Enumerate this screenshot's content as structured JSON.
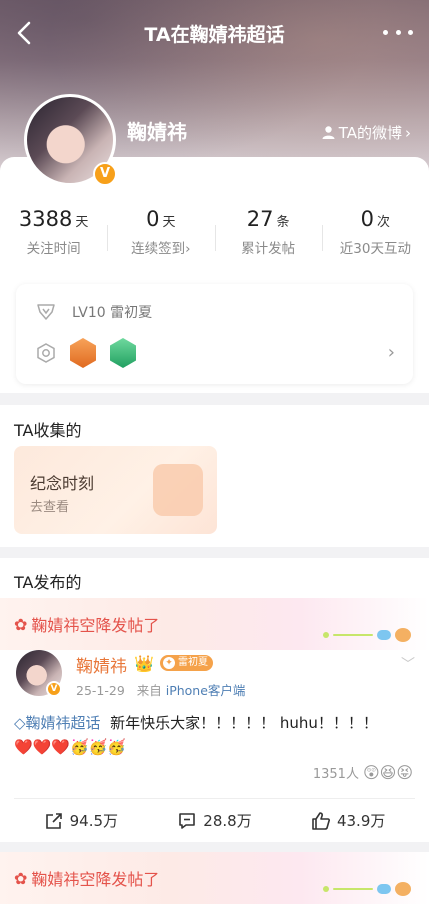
{
  "header": {
    "title": "TA在鞠婧祎超话",
    "colors": {
      "hero_top": "#7a6672",
      "accent": "#e4534b",
      "link": "#4f7fb4"
    }
  },
  "profile": {
    "name": "鞠婧祎",
    "verified_badge": "V",
    "weibo_link": "TA的微博"
  },
  "stats": [
    {
      "value": "3388",
      "unit": "天",
      "label": "关注时间"
    },
    {
      "value": "0",
      "unit": "天",
      "label": "连续签到"
    },
    {
      "value": "27",
      "unit": "条",
      "label": "累计发帖"
    },
    {
      "value": "0",
      "unit": "次",
      "label": "近30天互动"
    }
  ],
  "level": {
    "text": "LV10 雷初夏"
  },
  "collected": {
    "section_title": "TA收集的",
    "card_title": "纪念时刻",
    "card_action": "去查看"
  },
  "posts_section": {
    "title": "TA发布的"
  },
  "post": {
    "banner": "鞠婧祎空降发帖了",
    "author": "鞠婧祎",
    "level_tag": "雷初夏",
    "date": "25-1-29",
    "source_prefix": "来自",
    "source": "iPhone客户端",
    "topic": "鞠婧祎超话",
    "content": "新年快乐大家！！！！！ huhu！！！！",
    "emoji_line": "❤️❤️❤️🥳🥳🥳",
    "reaction_count": "1351人",
    "reaction_emojis": "😲😆😝",
    "actions": {
      "share": "94.5万",
      "comment": "28.8万",
      "like": "43.9万"
    }
  },
  "next_post": {
    "banner": "鞠婧祎空降发帖了"
  }
}
